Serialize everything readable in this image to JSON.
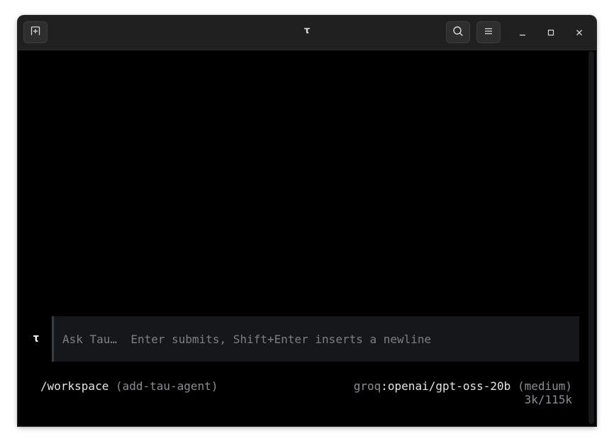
{
  "window": {
    "title": "τ"
  },
  "titlebar": {
    "new_tab_icon": "new-tab-icon",
    "search_icon": "search-icon",
    "menu_icon": "hamburger-menu-icon",
    "minimize_icon": "minimize-icon",
    "maximize_icon": "maximize-icon",
    "close_icon": "close-icon"
  },
  "composer": {
    "prompt_glyph": "τ",
    "placeholder": "Ask Tau…  Enter submits, Shift+Enter inserts a newline"
  },
  "status": {
    "path": "/workspace",
    "branch": "(add-tau-agent)",
    "provider": "groq",
    "separator": ":",
    "model": "openai/gpt-oss-20b",
    "effort": "(medium)",
    "tokens": "3k/115k"
  },
  "colors": {
    "background": "#000000",
    "titlebar": "#202020",
    "input_bg": "#15171b",
    "muted_text": "#8a8e95"
  }
}
